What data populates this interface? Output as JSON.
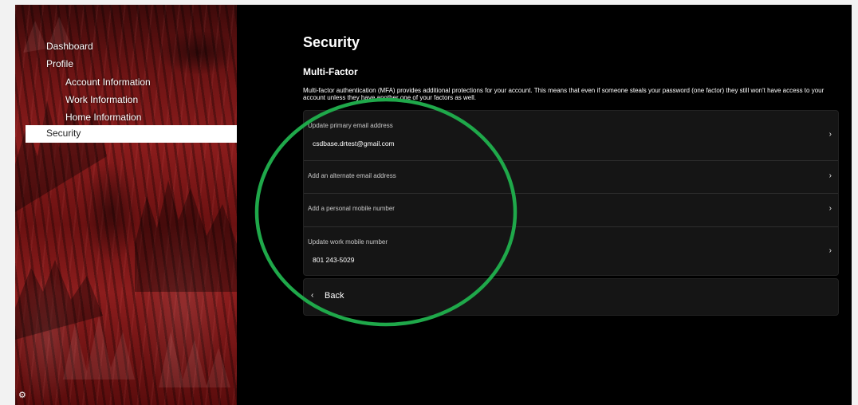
{
  "sidebar": {
    "items": [
      {
        "label": "Dashboard"
      },
      {
        "label": "Profile"
      },
      {
        "label": "Account Information"
      },
      {
        "label": "Work Information"
      },
      {
        "label": "Home Information"
      },
      {
        "label": "Security",
        "active": true
      }
    ],
    "settings_icon": "gear-icon"
  },
  "main": {
    "title": "Security",
    "section_title": "Multi-Factor",
    "description": "Multi-factor authentication (MFA) provides additional protections for your account. This means that even if someone steals your password (one factor) they still won't have access to your account unless they have another one of your factors as well.",
    "rows": [
      {
        "label": "Update primary email address",
        "value": "csdbase.drtest@gmail.com"
      },
      {
        "label": "Add an alternate email address",
        "value": ""
      },
      {
        "label": "Add a personal mobile number",
        "value": ""
      },
      {
        "label": "Update work mobile number",
        "value": "801 243-5029"
      }
    ],
    "chevron_icon": "chevron-right-icon",
    "back_label": "Back"
  },
  "colors": {
    "page_background": "#000000",
    "card_background": "#151515",
    "annotation_circle": "#1fa84a",
    "sidebar_tint": "#8a1c1c"
  }
}
